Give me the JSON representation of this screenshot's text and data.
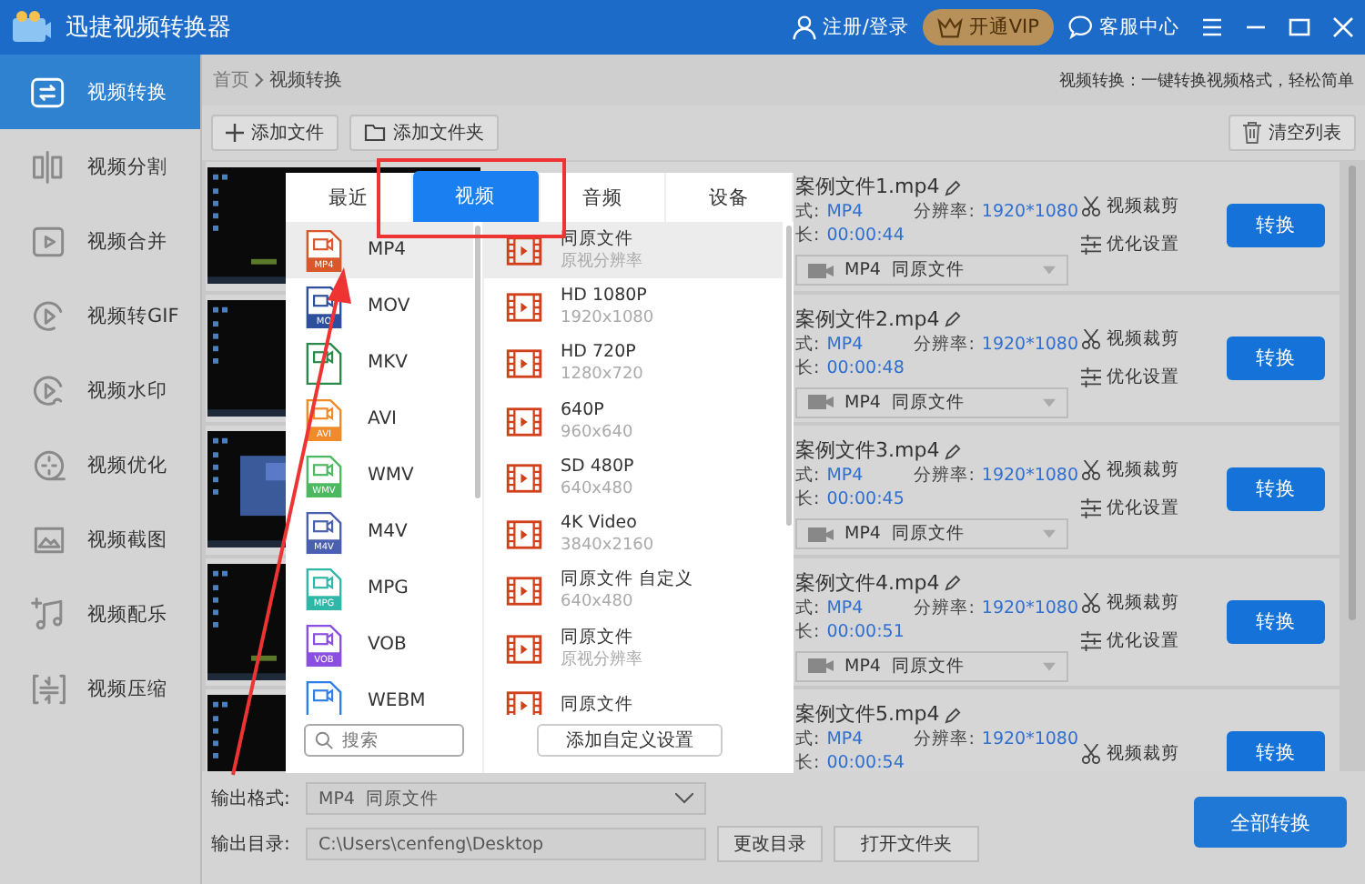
{
  "window": {
    "title": "迅捷视频转换器",
    "login": "注册/登录",
    "vip": "开通VIP",
    "service": "客服中心"
  },
  "sidebar": {
    "items": [
      {
        "label": "视频转换",
        "selected": true
      },
      {
        "label": "视频分割",
        "selected": false
      },
      {
        "label": "视频合并",
        "selected": false
      },
      {
        "label": "视频转GIF",
        "selected": false
      },
      {
        "label": "视频水印",
        "selected": false
      },
      {
        "label": "视频优化",
        "selected": false
      },
      {
        "label": "视频截图",
        "selected": false
      },
      {
        "label": "视频配乐",
        "selected": false
      },
      {
        "label": "视频压缩",
        "selected": false
      }
    ]
  },
  "breadcrumb": [
    "首页",
    "视频转换"
  ],
  "tagline": "视频转换：一键转换视频格式，轻松简单",
  "toolbar": {
    "add_file": "添加文件",
    "add_folder": "添加文件夹",
    "clear": "清空列表"
  },
  "files": [
    {
      "name": "案例文件1.mp4",
      "format_label": "式:",
      "format": "MP4",
      "resolution_label": "分辨率:",
      "resolution": "1920*1080",
      "duration_label": "长:",
      "duration": "00:00:44",
      "output": "MP4  同原文件",
      "trim": "视频裁剪",
      "optimize": "优化设置",
      "convert": "转换"
    },
    {
      "name": "案例文件2.mp4",
      "format_label": "式:",
      "format": "MP4",
      "resolution_label": "分辨率:",
      "resolution": "1920*1080",
      "duration_label": "长:",
      "duration": "00:00:48",
      "output": "MP4  同原文件",
      "trim": "视频裁剪",
      "optimize": "优化设置",
      "convert": "转换"
    },
    {
      "name": "案例文件3.mp4",
      "format_label": "式:",
      "format": "MP4",
      "resolution_label": "分辨率:",
      "resolution": "1920*1080",
      "duration_label": "长:",
      "duration": "00:00:45",
      "output": "MP4  同原文件",
      "trim": "视频裁剪",
      "optimize": "优化设置",
      "convert": "转换"
    },
    {
      "name": "案例文件4.mp4",
      "format_label": "式:",
      "format": "MP4",
      "resolution_label": "分辨率:",
      "resolution": "1920*1080",
      "duration_label": "长:",
      "duration": "00:00:51",
      "output": "MP4  同原文件",
      "trim": "视频裁剪",
      "optimize": "优化设置",
      "convert": "转换"
    },
    {
      "name": "案例文件5.mp4",
      "format_label": "式:",
      "format": "MP4",
      "resolution_label": "分辨率:",
      "resolution": "1920*1080",
      "duration_label": "长:",
      "duration": "00:00:54",
      "trim": "视频裁剪",
      "convert": "转换"
    }
  ],
  "popup": {
    "tabs": [
      {
        "label": "最近",
        "selected": false
      },
      {
        "label": "视频",
        "selected": true
      },
      {
        "label": "音频",
        "selected": false
      },
      {
        "label": "设备",
        "selected": false
      }
    ],
    "formats": [
      {
        "label": "MP4",
        "badge": "MP4",
        "color": "#d9582b",
        "selected": true
      },
      {
        "label": "MOV",
        "badge": "MO",
        "color": "#2d4f9e",
        "selected": false
      },
      {
        "label": "MKV",
        "color": "#2a8a4a",
        "selected": false
      },
      {
        "label": "AVI",
        "badge": "AVI",
        "color": "#f08a2a",
        "selected": false
      },
      {
        "label": "WMV",
        "badge": "WMV",
        "color": "#4cb860",
        "selected": false
      },
      {
        "label": "M4V",
        "badge": "M4V",
        "color": "#4a5fb0",
        "selected": false
      },
      {
        "label": "MPG",
        "badge": "MPG",
        "color": "#2fb8a8",
        "selected": false
      },
      {
        "label": "VOB",
        "badge": "VOB",
        "color": "#8a4fe0",
        "selected": false
      },
      {
        "label": "WEBM",
        "color": "#2f7fe8",
        "selected": false
      }
    ],
    "presets": [
      {
        "title": "同原文件",
        "subtitle": "原视分辨率",
        "selected": true
      },
      {
        "title": "HD 1080P",
        "subtitle": "1920x1080",
        "selected": false
      },
      {
        "title": "HD 720P",
        "subtitle": "1280x720",
        "selected": false
      },
      {
        "title": "640P",
        "subtitle": "960x640",
        "selected": false
      },
      {
        "title": "SD 480P",
        "subtitle": "640x480",
        "selected": false
      },
      {
        "title": "4K Video",
        "subtitle": "3840x2160",
        "selected": false
      },
      {
        "title": "同原文件 自定义",
        "subtitle": "640x480",
        "selected": false
      },
      {
        "title": "同原文件",
        "subtitle": "原视分辨率",
        "selected": false
      },
      {
        "title": "同原文件",
        "selected": false
      }
    ],
    "search": {
      "placeholder": "搜索"
    },
    "add_custom": "添加自定义设置"
  },
  "bottom": {
    "format_label": "输出格式:",
    "format_value": "MP4  同原文件",
    "dir_label": "输出目录:",
    "dir_value": "C:\\Users\\cenfeng\\Desktop",
    "change_dir": "更改目录",
    "open_folder": "打开文件夹",
    "convert_all": "全部转换"
  }
}
